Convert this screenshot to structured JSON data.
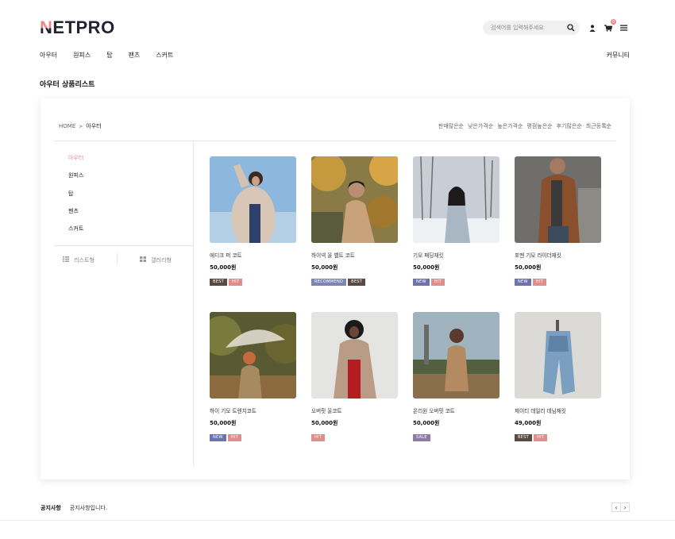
{
  "brand": {
    "logo_first": "N",
    "logo_rest": "ETPRO",
    "accent": "#e98a86"
  },
  "header": {
    "search_placeholder": "검색어를 입력해주세요",
    "cart_count": "0",
    "icons": [
      "search-icon",
      "user-icon",
      "cart-icon",
      "menu-icon"
    ]
  },
  "nav": {
    "items": [
      "아우터",
      "원피스",
      "탑",
      "팬츠",
      "스커트"
    ],
    "community": "커뮤니티"
  },
  "page_title": "아우터 상품리스트",
  "breadcrumb": {
    "home": "HOME",
    "sep": ">",
    "current": "아우터"
  },
  "sort_options": [
    "판매많은순",
    "낮은가격순",
    "높은가격순",
    "평점높은순",
    "후기많은순",
    "최근등록순"
  ],
  "sidebar": {
    "categories": [
      "아우터",
      "원피스",
      "탑",
      "팬츠",
      "스커트"
    ],
    "active": "아우터",
    "view_list": "리스트형",
    "view_gallery": "갤러리형"
  },
  "badge_colors": {
    "BEST": "#5a4a42",
    "HIT": "#e08d8d",
    "RECOMMEND": "#7b86b8",
    "NEW": "#6e73b0",
    "SALE": "#8c7ba6"
  },
  "products": [
    {
      "name": "에디크 퍼 코트",
      "price": "50,000원",
      "badges": [
        "BEST",
        "HIT"
      ]
    },
    {
      "name": "하이넥 울 벨트 코트",
      "price": "50,000원",
      "badges": [
        "RECOMMEND",
        "BEST"
      ]
    },
    {
      "name": "기모 패딩재킷",
      "price": "50,000원",
      "badges": [
        "NEW",
        "HIT"
      ]
    },
    {
      "name": "포멘 기모 라이더재킷",
      "price": "50,000원",
      "badges": [
        "NEW",
        "HIT"
      ]
    },
    {
      "name": "하이 기모 트렌치코트",
      "price": "50,000원",
      "badges": [
        "NEW",
        "HIT"
      ]
    },
    {
      "name": "오버핏 울코트",
      "price": "50,000원",
      "badges": [
        "HIT"
      ]
    },
    {
      "name": "온리원 오버핏 코트",
      "price": "50,000원",
      "badges": [
        "SALE"
      ]
    },
    {
      "name": "제이티 데일리 데님재킷",
      "price": "49,000원",
      "badges": [
        "BEST",
        "HIT"
      ]
    }
  ],
  "notice": {
    "label": "공지사항",
    "text": "공지사항입니다.",
    "prev": "‹",
    "next": "›"
  }
}
